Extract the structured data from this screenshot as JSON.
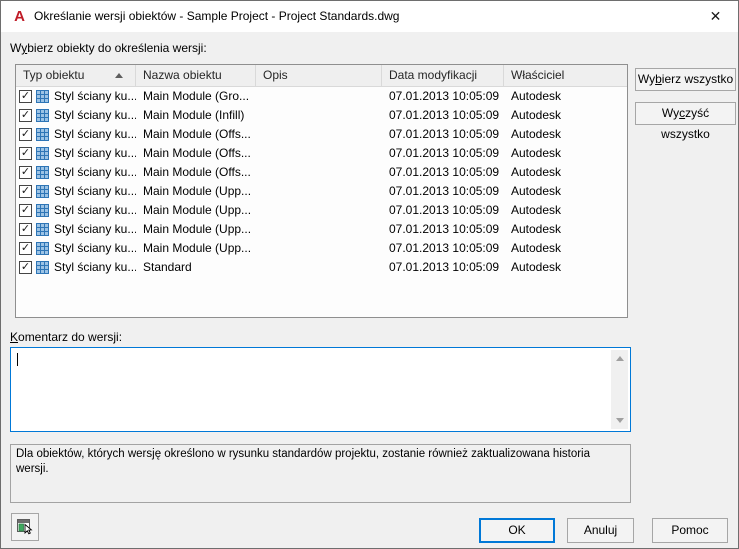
{
  "titlebar": {
    "logo_letter": "A",
    "title": "Określanie wersji obiektów - Sample Project - Project Standards.dwg",
    "close_glyph": "✕"
  },
  "labels": {
    "select_objects": {
      "pre": "W",
      "key": "y",
      "post": "bierz obiekty do określenia wersji:"
    },
    "comment": {
      "pre": "",
      "key": "K",
      "post": "omentarz do wersji:"
    },
    "info": "Dla obiektów, których wersję określono w rysunku standardów projektu, zostanie również zaktualizowana historia wersji."
  },
  "table": {
    "columns": [
      "Typ obiektu",
      "Nazwa obiektu",
      "Opis",
      "Data modyfikacji",
      "Właściciel"
    ],
    "sorted_column": "Typ obiektu",
    "sort_direction": "ascending",
    "rows": [
      {
        "checked": true,
        "type": "Styl ściany ku...",
        "name": "Main Module (Gro...",
        "description": "",
        "modified": "07.01.2013 10:05:09",
        "owner": "Autodesk"
      },
      {
        "checked": true,
        "type": "Styl ściany ku...",
        "name": "Main Module (Infill)",
        "description": "",
        "modified": "07.01.2013 10:05:09",
        "owner": "Autodesk"
      },
      {
        "checked": true,
        "type": "Styl ściany ku...",
        "name": "Main Module (Offs...",
        "description": "",
        "modified": "07.01.2013 10:05:09",
        "owner": "Autodesk"
      },
      {
        "checked": true,
        "type": "Styl ściany ku...",
        "name": "Main Module (Offs...",
        "description": "",
        "modified": "07.01.2013 10:05:09",
        "owner": "Autodesk"
      },
      {
        "checked": true,
        "type": "Styl ściany ku...",
        "name": "Main Module (Offs...",
        "description": "",
        "modified": "07.01.2013 10:05:09",
        "owner": "Autodesk"
      },
      {
        "checked": true,
        "type": "Styl ściany ku...",
        "name": "Main Module (Upp...",
        "description": "",
        "modified": "07.01.2013 10:05:09",
        "owner": "Autodesk"
      },
      {
        "checked": true,
        "type": "Styl ściany ku...",
        "name": "Main Module (Upp...",
        "description": "",
        "modified": "07.01.2013 10:05:09",
        "owner": "Autodesk"
      },
      {
        "checked": true,
        "type": "Styl ściany ku...",
        "name": "Main Module (Upp...",
        "description": "",
        "modified": "07.01.2013 10:05:09",
        "owner": "Autodesk"
      },
      {
        "checked": true,
        "type": "Styl ściany ku...",
        "name": "Main Module (Upp...",
        "description": "",
        "modified": "07.01.2013 10:05:09",
        "owner": "Autodesk"
      },
      {
        "checked": true,
        "type": "Styl ściany ku...",
        "name": "Standard",
        "description": "",
        "modified": "07.01.2013 10:05:09",
        "owner": "Autodesk"
      }
    ]
  },
  "side_buttons": {
    "select_all": {
      "pre": "Wy",
      "key": "b",
      "post": "ierz wszystko"
    },
    "clear_all": {
      "pre": "Wy",
      "key": "c",
      "post": "zyść wszystko"
    }
  },
  "comment_box": {
    "value": ""
  },
  "footer_buttons": {
    "ok": "OK",
    "cancel": "Anuluj",
    "help": "Pomoc"
  },
  "colors": {
    "accent_blue": "#0078d7",
    "logo_red": "#c01c28",
    "icon_blue_fill": "#9cc3e5",
    "icon_blue_line": "#2e75b6"
  }
}
